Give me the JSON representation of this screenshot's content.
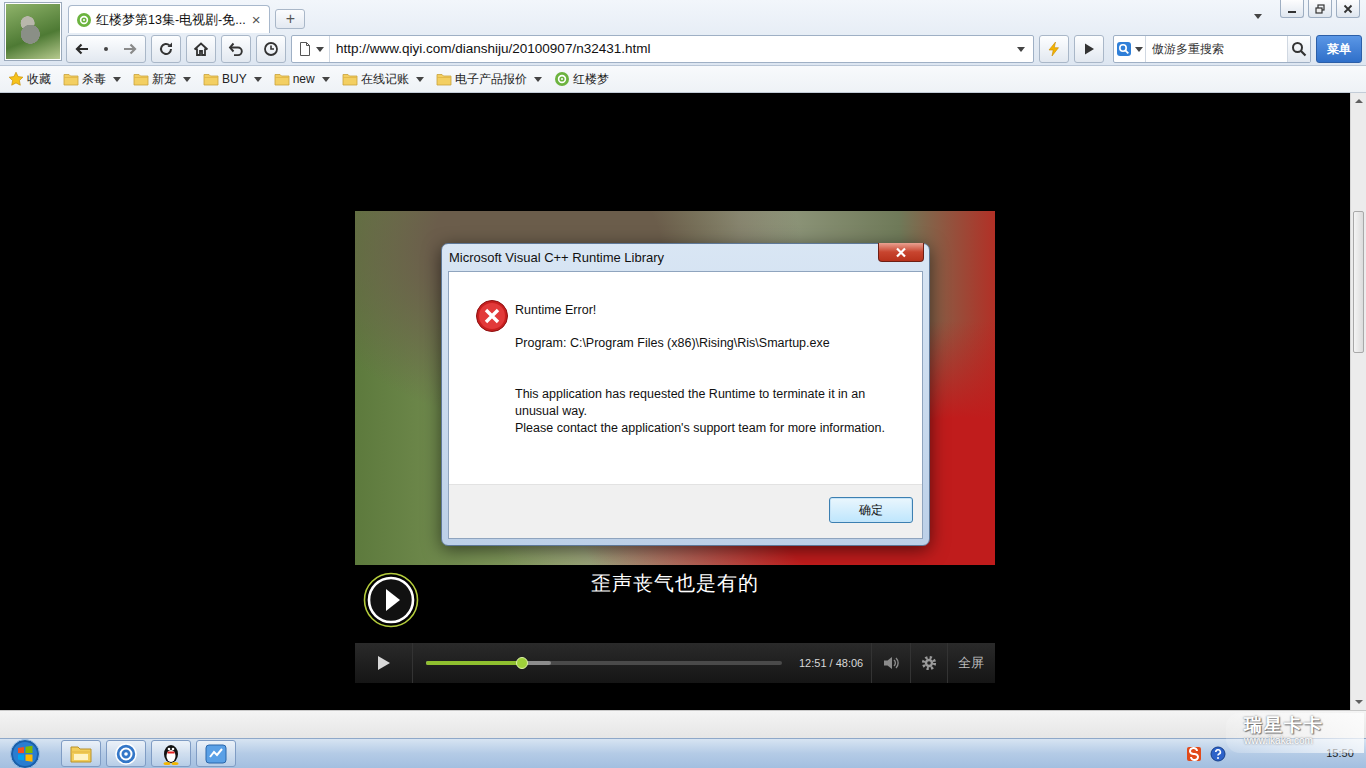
{
  "browser": {
    "tabs": [
      {
        "label": "红楼梦第13集-电视剧-免...",
        "selected": true,
        "close": "×"
      }
    ],
    "new_tab": "+",
    "address": {
      "url": "http://www.qiyi.com/dianshiju/20100907/n32431.html"
    },
    "search": {
      "placeholder": "傲游多重搜索"
    },
    "menu": "菜单",
    "bookmarks": [
      {
        "label": "收藏",
        "kind": "star"
      },
      {
        "label": "杀毒",
        "kind": "folder"
      },
      {
        "label": "新宠",
        "kind": "folder"
      },
      {
        "label": "BUY",
        "kind": "folder"
      },
      {
        "label": "new",
        "kind": "folder"
      },
      {
        "label": "在线记账",
        "kind": "folder"
      },
      {
        "label": "电子产品报价",
        "kind": "folder"
      },
      {
        "label": "红楼梦",
        "kind": "site"
      }
    ],
    "page_scroll": {
      "level": 0.23
    }
  },
  "player": {
    "playing": false,
    "subtitle": "歪声丧气也是有的",
    "progress": {
      "level": 0.27
    },
    "buffered": {
      "level": 0.35
    },
    "time": "12:51 / 48:06",
    "fullscreen": "全屏"
  },
  "dialog": {
    "title": "Microsoft Visual C++ Runtime Library",
    "heading": "Runtime Error!",
    "program": "Program: C:\\Program Files (x86)\\Rising\\Ris\\Smartup.exe",
    "message": [
      "This application has requested the Runtime to terminate it in an unusual way.",
      "Please contact the application's support team for more information."
    ],
    "buttons": [
      "确定"
    ]
  },
  "taskbar": {
    "apps": [
      {
        "kind": "explorer"
      },
      {
        "kind": "maxthon"
      },
      {
        "kind": "qq"
      },
      {
        "kind": "rising"
      }
    ],
    "tray": [
      {
        "kind": "sogou"
      },
      {
        "kind": "help"
      }
    ],
    "clock": "15:50"
  },
  "watermark": {
    "title": "瑞星卡卡",
    "url": "www.ikaka.com"
  }
}
